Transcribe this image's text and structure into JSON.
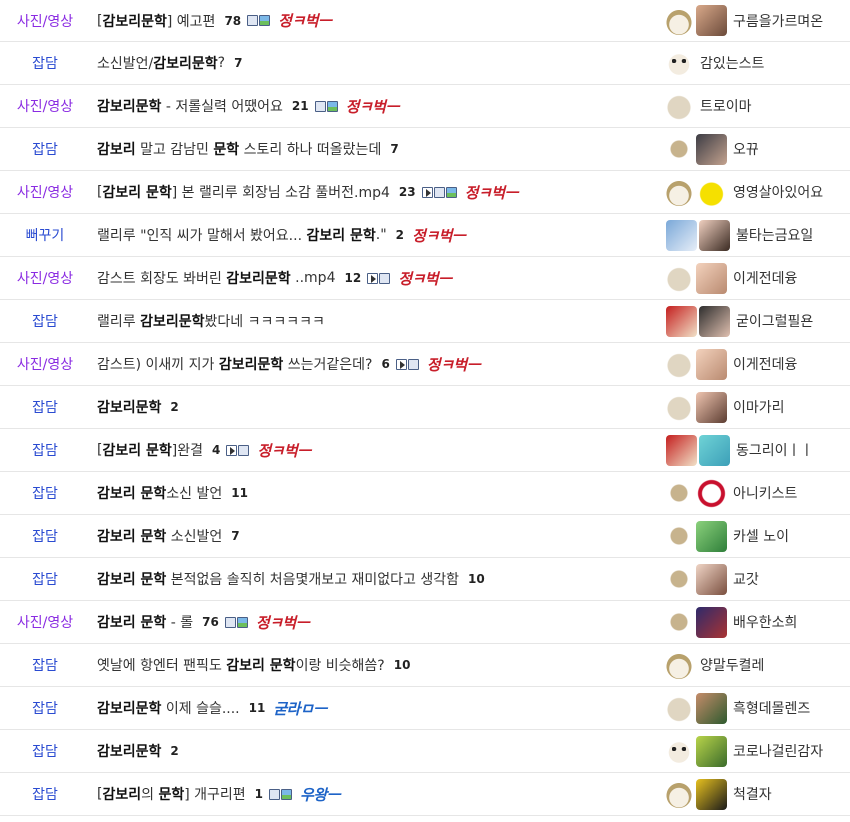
{
  "rows": [
    {
      "category": "사진/영상",
      "cat_color": "purple",
      "title": [
        {
          "t": "[",
          "b": false
        },
        {
          "t": "감보리문학",
          "b": true
        },
        {
          "t": "] 예고편",
          "b": false
        }
      ],
      "count": "78",
      "icons": [
        "disk",
        "pic"
      ],
      "badge": "정ㅋ벅ㅡ",
      "badge_color": "red",
      "avatar1": "fox",
      "avatar2": "a",
      "nick": "구름을가르며온"
    },
    {
      "category": "잡담",
      "cat_color": "blue",
      "title": [
        {
          "t": "소신발언/",
          "b": false
        },
        {
          "t": "감보리문학",
          "b": true
        },
        {
          "t": "?",
          "b": false
        }
      ],
      "count": "7",
      "icons": [],
      "badge": "",
      "badge_color": "",
      "avatar1": "dog",
      "avatar2": "",
      "nick": "감있는스트"
    },
    {
      "category": "사진/영상",
      "cat_color": "purple",
      "title": [
        {
          "t": "감보리문학",
          "b": true
        },
        {
          "t": " - 저롤실력 어땠어요",
          "b": false
        }
      ],
      "count": "21",
      "icons": [
        "disk",
        "pic"
      ],
      "badge": "정ㅋ벅ㅡ",
      "badge_color": "red",
      "avatar1": "blob",
      "avatar2": "",
      "nick": "트로이마"
    },
    {
      "category": "잡담",
      "cat_color": "blue",
      "title": [
        {
          "t": "감보리",
          "b": true
        },
        {
          "t": " 말고 감남민 ",
          "b": false
        },
        {
          "t": "문학",
          "b": true
        },
        {
          "t": " 스토리 하나 떠올랐는데",
          "b": false
        }
      ],
      "count": "7",
      "icons": [],
      "badge": "",
      "badge_color": "",
      "avatar1": "dot",
      "avatar2": "b",
      "nick": "오뀨"
    },
    {
      "category": "사진/영상",
      "cat_color": "purple",
      "title": [
        {
          "t": "[",
          "b": false
        },
        {
          "t": "감보리 문학",
          "b": true
        },
        {
          "t": "] 본 랠리루 회장님 소감 풀버전.mp4",
          "b": false
        }
      ],
      "count": "23",
      "icons": [
        "vid",
        "disk",
        "pic"
      ],
      "badge": "정ㅋ벅ㅡ",
      "badge_color": "red",
      "avatar1": "fox",
      "avatar2": "c",
      "nick": "영영살아있어요"
    },
    {
      "category": "뻐꾸기",
      "cat_color": "blue",
      "title": [
        {
          "t": "랠리루 \"인직 씨가 말해서 봤어요... ",
          "b": false
        },
        {
          "t": "감보리 문학",
          "b": true
        },
        {
          "t": ".\"",
          "b": false
        }
      ],
      "count": "2",
      "icons": [],
      "badge": "정ㅋ벅ㅡ",
      "badge_color": "red",
      "avatar1": "p",
      "avatar2": "d",
      "nick": "불타는금요일"
    },
    {
      "category": "사진/영상",
      "cat_color": "purple",
      "title": [
        {
          "t": "감스트 회장도 봐버린 ",
          "b": false
        },
        {
          "t": "감보리문학",
          "b": true
        },
        {
          "t": " ..mp4",
          "b": false
        }
      ],
      "count": "12",
      "icons": [
        "vid",
        "disk"
      ],
      "badge": "정ㅋ벅ㅡ",
      "badge_color": "red",
      "avatar1": "blob",
      "avatar2": "e",
      "nick": "이게전데융"
    },
    {
      "category": "잡담",
      "cat_color": "blue",
      "title": [
        {
          "t": "랠리루 ",
          "b": false
        },
        {
          "t": "감보리문학",
          "b": true
        },
        {
          "t": "봤다네 ㅋㅋㅋㅋㅋㅋ",
          "b": false
        }
      ],
      "count": "",
      "icons": [],
      "badge": "",
      "badge_color": "",
      "avatar1": "q",
      "avatar2": "f",
      "nick": "굳이그럴필욘"
    },
    {
      "category": "사진/영상",
      "cat_color": "purple",
      "title": [
        {
          "t": "감스트) 이새끼 지가 ",
          "b": false
        },
        {
          "t": "감보리문학",
          "b": true
        },
        {
          "t": " 쓰는거같은데?",
          "b": false
        }
      ],
      "count": "6",
      "icons": [
        "vid",
        "disk"
      ],
      "badge": "정ㅋ벅ㅡ",
      "badge_color": "red",
      "avatar1": "blob",
      "avatar2": "e",
      "nick": "이게전데융"
    },
    {
      "category": "잡담",
      "cat_color": "blue",
      "title": [
        {
          "t": "감보리문학",
          "b": true
        }
      ],
      "count": "2",
      "icons": [],
      "badge": "",
      "badge_color": "",
      "avatar1": "blob",
      "avatar2": "g",
      "nick": "이마가리"
    },
    {
      "category": "잡담",
      "cat_color": "blue",
      "title": [
        {
          "t": "[",
          "b": false
        },
        {
          "t": "감보리 문학",
          "b": true
        },
        {
          "t": "]완결",
          "b": false
        }
      ],
      "count": "4",
      "icons": [
        "vid",
        "disk"
      ],
      "badge": "정ㅋ벅ㅡ",
      "badge_color": "red",
      "avatar1": "q",
      "avatar2": "h",
      "nick": "동그리이ㅣㅣ"
    },
    {
      "category": "잡담",
      "cat_color": "blue",
      "title": [
        {
          "t": "감보리 문학",
          "b": true
        },
        {
          "t": "소신 발언",
          "b": false
        }
      ],
      "count": "11",
      "icons": [],
      "badge": "",
      "badge_color": "",
      "avatar1": "dot",
      "avatar2": "i",
      "nick": "아니키스트"
    },
    {
      "category": "잡담",
      "cat_color": "blue",
      "title": [
        {
          "t": "감보리 문학",
          "b": true
        },
        {
          "t": " 소신발언",
          "b": false
        }
      ],
      "count": "7",
      "icons": [],
      "badge": "",
      "badge_color": "",
      "avatar1": "dot",
      "avatar2": "j",
      "nick": "카셀 노이"
    },
    {
      "category": "잡담",
      "cat_color": "blue",
      "title": [
        {
          "t": "감보리 문학",
          "b": true
        },
        {
          "t": " 본적없음 솔직히 처음몇개보고 재미없다고 생각함",
          "b": false
        }
      ],
      "count": "10",
      "icons": [],
      "badge": "",
      "badge_color": "",
      "avatar1": "dot",
      "avatar2": "k",
      "nick": "교갓"
    },
    {
      "category": "사진/영상",
      "cat_color": "purple",
      "title": [
        {
          "t": "감보리 문학",
          "b": true
        },
        {
          "t": " - 롤",
          "b": false
        }
      ],
      "count": "76",
      "icons": [
        "disk",
        "pic"
      ],
      "badge": "정ㅋ벅ㅡ",
      "badge_color": "red",
      "avatar1": "dot",
      "avatar2": "l",
      "nick": "배우한소희"
    },
    {
      "category": "잡담",
      "cat_color": "blue",
      "title": [
        {
          "t": "옛날에 항엔터 팬픽도 ",
          "b": false
        },
        {
          "t": "감보리 문학",
          "b": true
        },
        {
          "t": "이랑 비슷해씀?",
          "b": false
        }
      ],
      "count": "10",
      "icons": [],
      "badge": "",
      "badge_color": "",
      "avatar1": "fox",
      "avatar2": "",
      "nick": "양말두켤레"
    },
    {
      "category": "잡담",
      "cat_color": "blue",
      "title": [
        {
          "t": "감보리문학",
          "b": true
        },
        {
          "t": " 이제 슬슬....",
          "b": false
        }
      ],
      "count": "11",
      "icons": [],
      "badge": "굳라ㅁㅡ",
      "badge_color": "blue",
      "avatar1": "blob",
      "avatar2": "m",
      "nick": "흑형데몰렌즈"
    },
    {
      "category": "잡담",
      "cat_color": "blue",
      "title": [
        {
          "t": "감보리문학",
          "b": true
        }
      ],
      "count": "2",
      "icons": [],
      "badge": "",
      "badge_color": "",
      "avatar1": "dog",
      "avatar2": "n",
      "nick": "코로나걸린감자"
    },
    {
      "category": "잡담",
      "cat_color": "blue",
      "title": [
        {
          "t": "[",
          "b": false
        },
        {
          "t": "감보리",
          "b": true
        },
        {
          "t": "의 ",
          "b": false
        },
        {
          "t": "문학",
          "b": true
        },
        {
          "t": "] 개구리편",
          "b": false
        }
      ],
      "count": "1",
      "icons": [
        "disk",
        "pic"
      ],
      "badge": "우왕ㅡ",
      "badge_color": "blue",
      "avatar1": "fox",
      "avatar2": "o",
      "nick": "척결자"
    }
  ]
}
